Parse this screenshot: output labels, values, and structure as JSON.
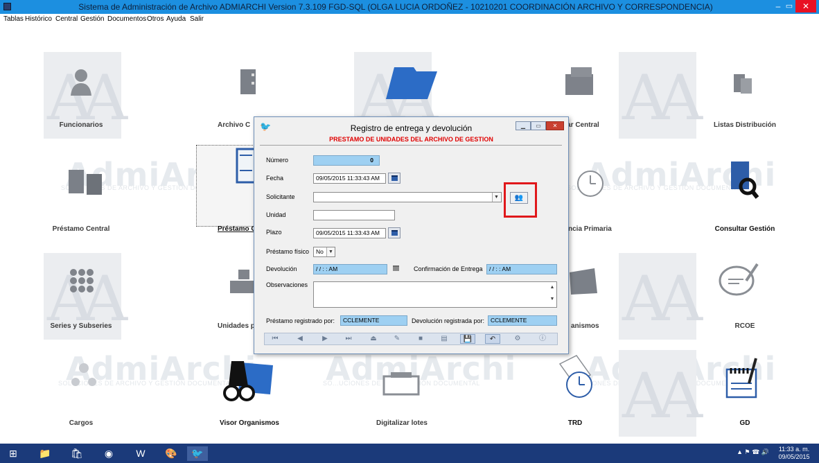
{
  "window": {
    "title": "Sistema de Administración de Archivo ADMIARCHI Version 7.3.109 FGD-SQL (OLGA LUCIA ORDOÑEZ - 10210201 COORDINACIÓN ARCHIVO Y CORRESPONDENCIA)",
    "min": "–",
    "max": "▭",
    "close": "✕"
  },
  "menu": [
    "Tablas",
    "Histórico",
    "Central",
    "Gestión",
    "Documentos",
    "Otros",
    "Ayuda",
    "Salir"
  ],
  "tiles": {
    "funcionarios": "Funcionarios",
    "archivo_central": "Archivo C",
    "consultar_central": "ltar Central",
    "listas_distribucion": "Listas Distribución",
    "prestamo_central": "Préstamo Central",
    "prestamo_gestion": "Préstamo G",
    "transferencia_primaria": "ncia Primaria",
    "consultar_gestion": "Consultar Gestión",
    "series_subseries": "Series y Subseries",
    "unidades": "Unidades pro",
    "organismos": "anismos",
    "rcoe": "RCOE",
    "cargos": "Cargos",
    "visor_organismos": "Visor Organismos",
    "digitalizar_lotes": "Digitalizar lotes",
    "trd": "TRD",
    "gd": "GD"
  },
  "watermark": {
    "letters": "AA",
    "brand": "AdmiArchi",
    "brand_sub_1": "SOLUCIONES DE ARCHIVO Y GESTIÓN DOCUMENTAL",
    "brand_sub_2": "SO...UCIONES DE ARCHI    ESTIÓN DOCUMENTAL"
  },
  "dialog": {
    "title": "Registro de entrega y devolución",
    "subtitle": "PRESTAMO DE UNIDADES DEL ARCHIVO DE GESTION",
    "labels": {
      "numero": "Número",
      "fecha": "Fecha",
      "solicitante": "Solicitante",
      "unidad": "Unidad",
      "plazo": "Plazo",
      "prestamo_fisico": "Préstamo físico",
      "devolucion": "Devolución",
      "confirmacion": "Confirmación de Entrega",
      "observaciones": "Observaciones",
      "prestamo_registrado": "Préstamo registrado por:",
      "devolucion_registrada": "Devolución registrada por:"
    },
    "values": {
      "numero": "0",
      "fecha": "09/05/2015 11:33:43 AM",
      "solicitante": "",
      "unidad": "",
      "plazo": "09/05/2015 11:33:43 AM",
      "prestamo_fisico": "No",
      "devolucion": "/ /      : :  AM",
      "confirmacion": "/ /      : :  AM",
      "observaciones": "",
      "prestamo_registrado": "CCLEMENTE",
      "devolucion_registrada": "CCLEMENTE"
    }
  },
  "taskbar": {
    "apps": [
      "windows-start",
      "file-explorer",
      "store",
      "chrome",
      "word",
      "paint",
      "admiarchi"
    ],
    "time": "11:33 a. m.",
    "date": "09/05/2015"
  },
  "colors": {
    "titlebar": "#1c8fe0",
    "close": "#e81123",
    "subtitle_red": "#e00000",
    "field_blue": "#9ed0f2",
    "highlight_box": "#e0181b",
    "taskbar": "#1b3a7a"
  }
}
